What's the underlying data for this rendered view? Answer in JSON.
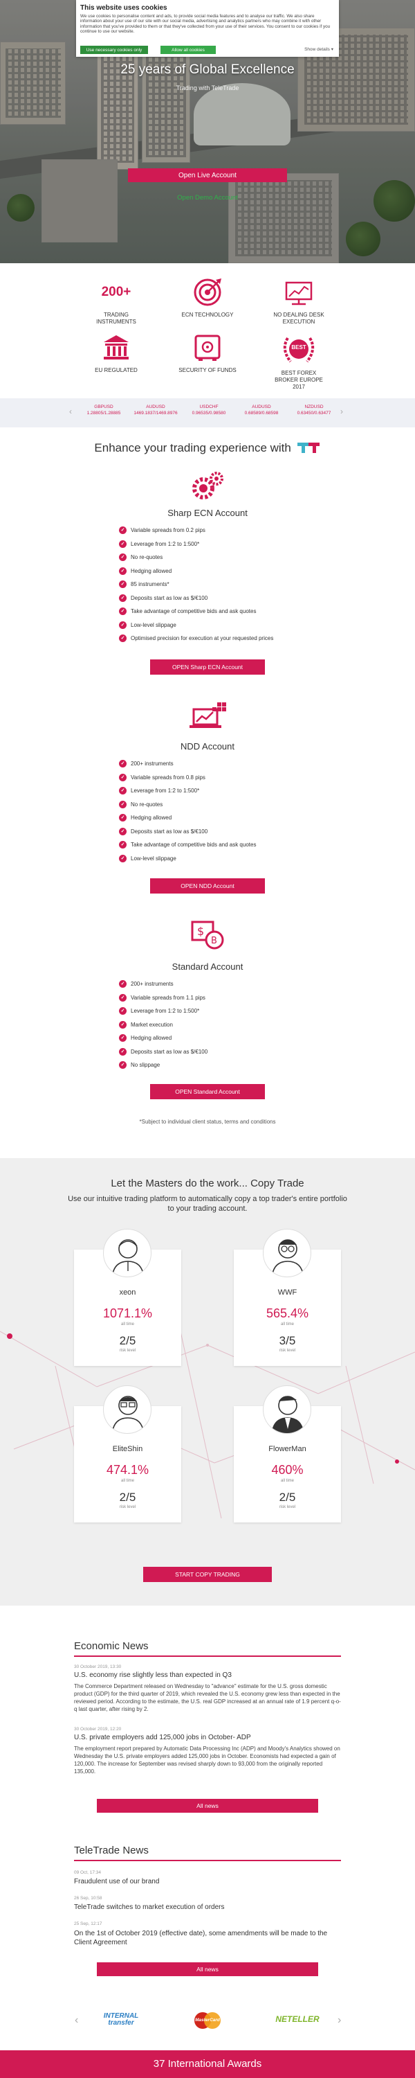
{
  "cookie_banner": {
    "title": "This website uses cookies",
    "text": "We use cookies to personalise content and ads, to provide social media features and to analyse our traffic. We also share information about your use of our site with our social media, advertising and analytics partners who may combine it with other information that you've provided to them or that they've collected from your use of their services. You consent to our cookies if you continue to use our website.",
    "necessary_label": "Use necessary cookies only",
    "allow_all_label": "Allow all cookies",
    "details_label": "Show details"
  },
  "hero": {
    "title": "25 years of Global Excellence",
    "subtitle": "Trading with TeleTrade",
    "open_live_label": "Open Live Account",
    "open_demo_label": "Open Demo Account"
  },
  "features": [
    {
      "big": "200+",
      "label": "TRADING INSTRUMENTS",
      "icon": "200-plus-icon"
    },
    {
      "label": "ECN TECHNOLOGY",
      "icon": "ecn-target-icon"
    },
    {
      "label": "NO DEALING DESK EXECUTION",
      "icon": "no-dealing-desk-icon"
    },
    {
      "label": "EU REGULATED",
      "icon": "eu-building-icon"
    },
    {
      "label": "SECURITY OF FUNDS",
      "icon": "safe-icon"
    },
    {
      "label": "BEST FOREX BROKER EUROPE 2017",
      "icon": "award-wreath-icon",
      "badge": "BEST"
    }
  ],
  "ticker": [
    {
      "pair": "GBPUSD",
      "value": "1.28805/1.28885"
    },
    {
      "pair": "AUDUSD",
      "value": "1469.1837/1469.8976"
    },
    {
      "pair": "USDCHF",
      "value": "0.96535/0.98580"
    },
    {
      "pair": "AUDUSD",
      "value": "0.68589/0.68598"
    },
    {
      "pair": "NZDUSD",
      "value": "0.63450/0.63477"
    }
  ],
  "enhance_title": "Enhance your trading experience with",
  "accounts": [
    {
      "title": "Sharp ECN Account",
      "features": [
        "Variable spreads from 0.2 pips",
        "Leverage from 1:2 to 1:500*",
        "No re-quotes",
        "Hedging allowed",
        "85 instruments*",
        "Deposits start as low as $/€100",
        "Take advantage of competitive bids and ask quotes",
        "Low-level slippage",
        "Optimised precision for execution at your requested prices"
      ],
      "button": "OPEN Sharp ECN Account"
    },
    {
      "title": "NDD Account",
      "features": [
        "200+ instruments",
        "Variable spreads from 0.8 pips",
        "Leverage from 1:2 to 1:500*",
        "No re-quotes",
        "Hedging allowed",
        "Deposits start as low as $/€100",
        "Take advantage of competitive bids and ask quotes",
        "Low-level slippage"
      ],
      "button": "OPEN NDD Account"
    },
    {
      "title": "Standard Account",
      "features": [
        "200+ instruments",
        "Variable spreads from 1.1 pips",
        "Leverage from 1:2 to 1:500*",
        "Market execution",
        "Hedging allowed",
        "Deposits start as low as $/€100",
        "No slippage"
      ],
      "button": "OPEN Standard Account"
    }
  ],
  "subject_note": "*Subject to individual client status, terms and conditions",
  "copy_trade": {
    "title": "Let the Masters do the work... Copy Trade",
    "subtitle": "Use our intuitive trading platform to automatically copy a top trader's entire portfolio to your trading account.",
    "traders": [
      {
        "name": "xeon",
        "return": "1071.1%",
        "period": "all time",
        "risk": "2/5",
        "risk_label": "risk level"
      },
      {
        "name": "WWF",
        "return": "565.4%",
        "period": "all time",
        "risk": "3/5",
        "risk_label": "risk level"
      },
      {
        "name": "EliteShin",
        "return": "474.1%",
        "period": "all time",
        "risk": "2/5",
        "risk_label": "risk level"
      },
      {
        "name": "FlowerMan",
        "return": "460%",
        "period": "all time",
        "risk": "2/5",
        "risk_label": "risk level"
      }
    ],
    "button": "START COPY TRADING"
  },
  "economic_news": {
    "title": "Economic News",
    "items": [
      {
        "date": "30 October 2019, 13:30",
        "headline": "U.S. economy rise slightly less than expected in Q3",
        "body": "The Commerce Department released on Wednesday to \"advance\" estimate for the U.S. gross domestic product (GDP) for the third quarter of 2019, which revealed the U.S. economy grew less than expected in the reviewed period. According to the estimate, the U.S. real GDP increased at an annual rate of 1.9 percent q-o-q last quarter, after rising by 2."
      },
      {
        "date": "30 October 2019, 12:20",
        "headline": "U.S. private employers add 125,000 jobs in October- ADP",
        "body": "The employment report prepared by Automatic Data Processing Inc (ADP) and Moody's Analytics showed on Wednesday the U.S. private employers added 125,000 jobs in October. Economists had expected a gain of 120,000. The increase for September was revised sharply down to 93,000 from the originally reported 135,000."
      }
    ],
    "button": "All news"
  },
  "teletrade_news": {
    "title": "TeleTrade News",
    "items": [
      {
        "date": "09 Oct, 17:34",
        "headline": "Fraudulent use of our brand"
      },
      {
        "date": "26 Sep, 10:58",
        "headline": "TeleTrade switches to market execution of orders"
      },
      {
        "date": "25 Sep, 12:17",
        "headline": "On the 1st of October 2019 (effective date), some amendments will be made to the Client Agreement"
      }
    ],
    "button": "All news"
  },
  "payments": [
    {
      "name": "INTERNAL transfer",
      "icon": "internal-transfer-logo"
    },
    {
      "name": "MasterCard",
      "icon": "mastercard-logo"
    },
    {
      "name": "NETELLER",
      "icon": "neteller-logo"
    }
  ],
  "awards_label": "37 International Awards",
  "colors": {
    "accent": "#d01a53",
    "green": "#2fb24a",
    "ticker_bg": "#eef0f5",
    "copy_bg": "#efefef"
  }
}
